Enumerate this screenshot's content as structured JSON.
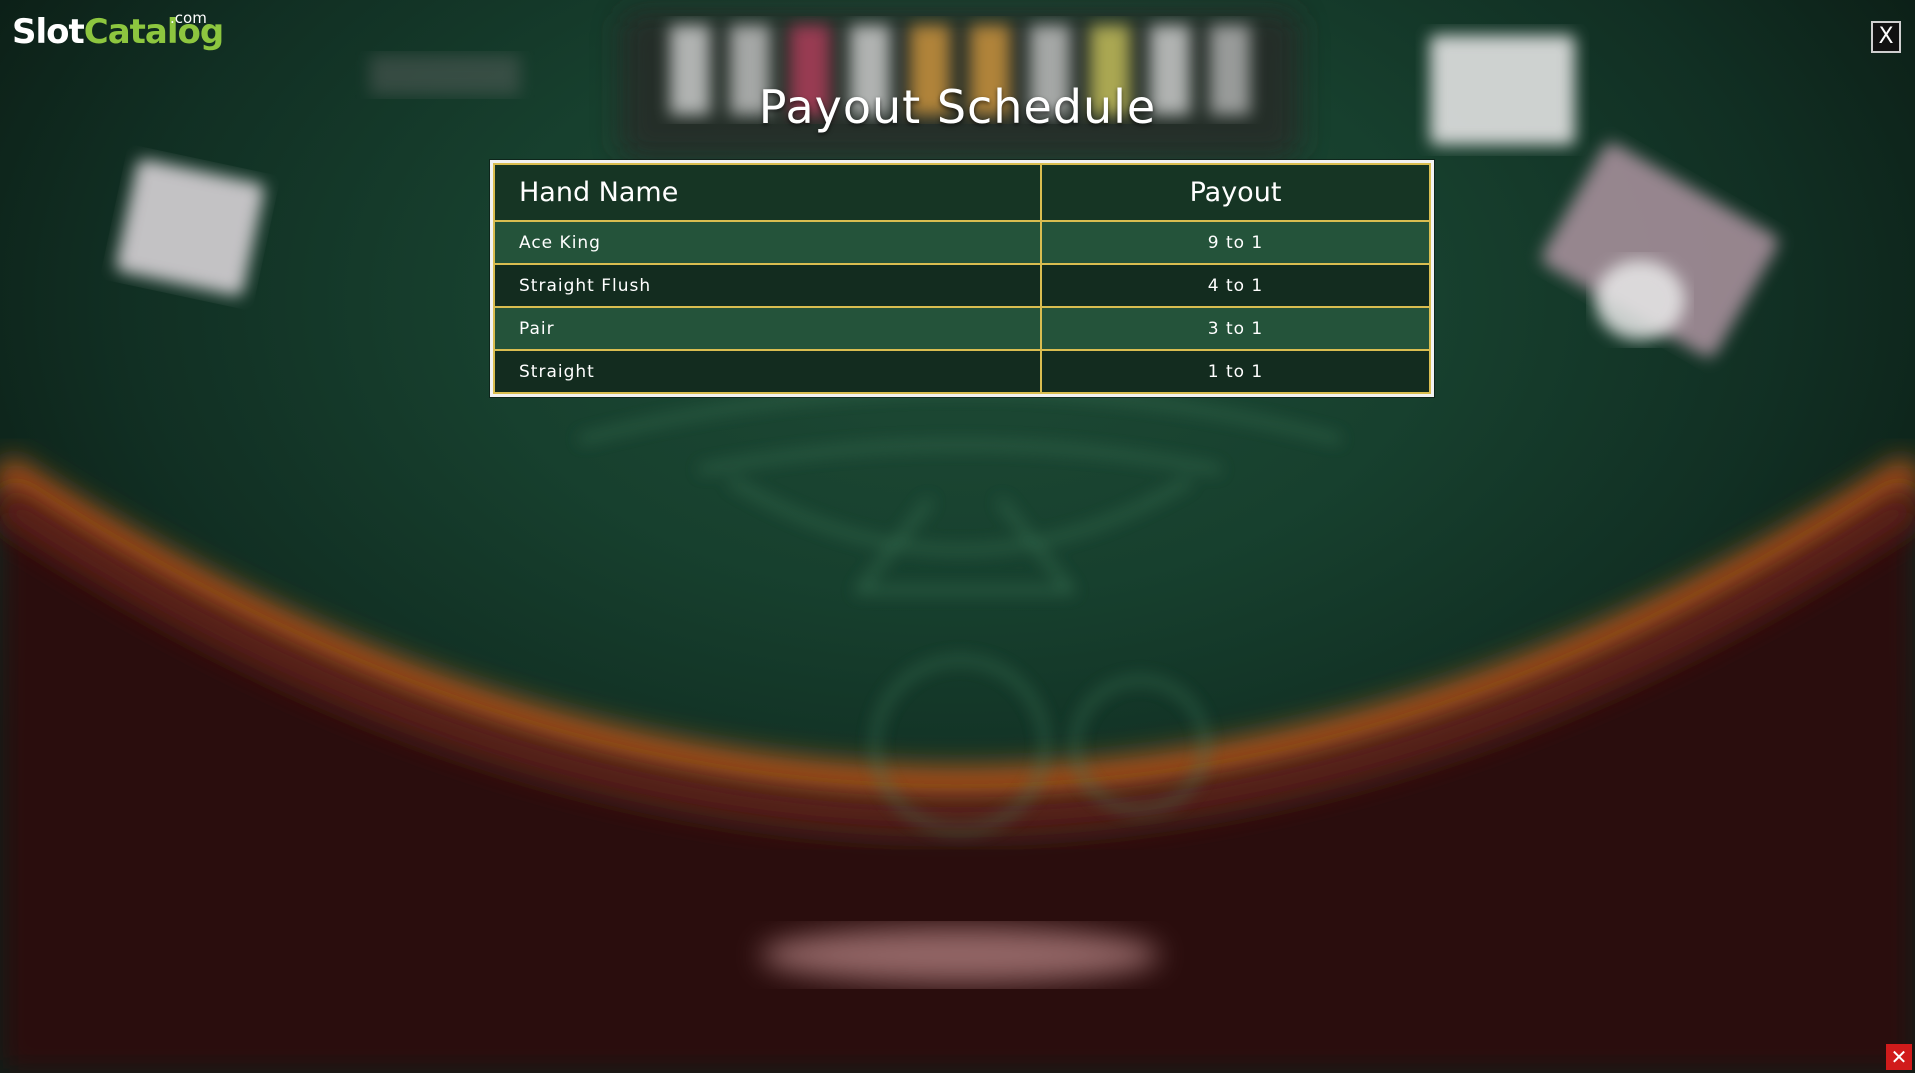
{
  "logo": {
    "slot": "Slot",
    "catalog": "Catalog",
    "com": ".com"
  },
  "close_button": {
    "label": "X"
  },
  "ad_close": {
    "label": "✕"
  },
  "title": "Payout Schedule",
  "table": {
    "headers": {
      "name": "Hand Name",
      "payout": "Payout"
    },
    "rows": [
      {
        "name": "Ace King",
        "payout": "9 to 1"
      },
      {
        "name": "Straight Flush",
        "payout": "4 to 1"
      },
      {
        "name": "Pair",
        "payout": "3 to 1"
      },
      {
        "name": "Straight",
        "payout": "1 to 1"
      }
    ]
  },
  "colors": {
    "felt": "#1e4a35",
    "table_border_gold": "#d9bd50",
    "rail_orange": "#b8581a",
    "logo_green": "#8dc63f"
  }
}
